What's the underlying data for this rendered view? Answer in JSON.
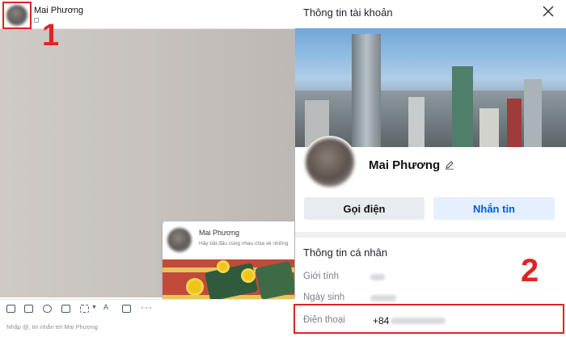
{
  "chat": {
    "contact_name": "Mai Phương",
    "card": {
      "name": "Mai Phương",
      "description": "Hãy bắt đầu cùng nhau chia sẻ những"
    },
    "input_placeholder": "Nhập @, tin nhắn tới Mai Phương"
  },
  "annotations": {
    "marker_1": "1",
    "marker_2": "2",
    "marker_color": "#e02424"
  },
  "info_panel": {
    "title": "Thông tin tài khoản",
    "profile_name": "Mai Phương",
    "call_button": "Gọi điện",
    "message_button": "Nhắn tin",
    "message_button_color": "#005ae0",
    "section_title": "Thông tin cá nhân",
    "fields": {
      "gender_label": "Giới tính",
      "birthday_label": "Ngày sinh",
      "phone_label": "Điện thoại",
      "phone_prefix": "+84"
    }
  },
  "icons": [
    "close-icon",
    "edit-icon",
    "emoji-icon",
    "image-icon",
    "attachment-icon",
    "screenshot-icon",
    "file-icon",
    "format-icon",
    "reminder-icon",
    "more-icon"
  ]
}
